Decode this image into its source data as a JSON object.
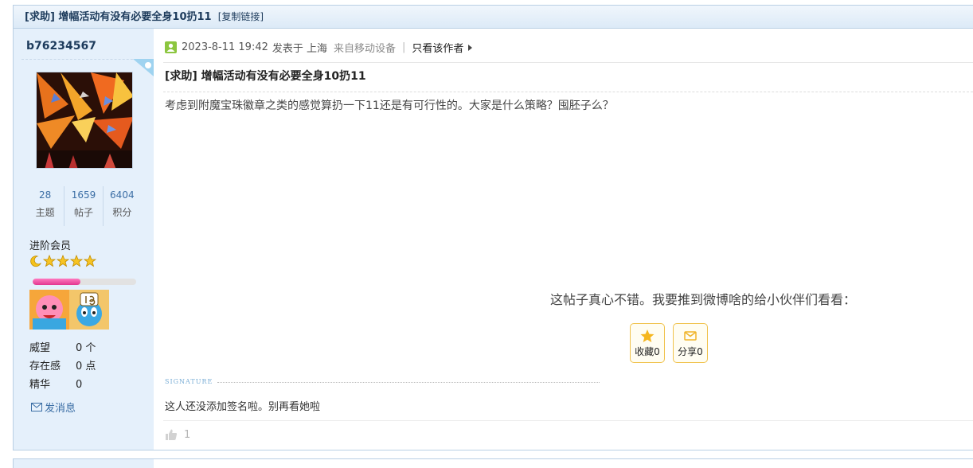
{
  "thread": {
    "title": "[求助] 增幅活动有没有必要全身10扔11",
    "copy_link": "[复制链接]"
  },
  "author": {
    "username": "b76234567",
    "stats": [
      {
        "value": "28",
        "label": "主题"
      },
      {
        "value": "1659",
        "label": "帖子"
      },
      {
        "value": "6404",
        "label": "积分"
      }
    ],
    "rank": "进阶会员",
    "level_progress": 0.46,
    "profile": [
      {
        "key": "威望",
        "value": "0 个"
      },
      {
        "key": "存在感",
        "value": "0 点"
      },
      {
        "key": "精华",
        "value": "0"
      }
    ],
    "send_message": "发消息"
  },
  "post": {
    "datetime": "2023-8-11 19:42",
    "posted_at": "发表于 上海",
    "device": "来自移动设备",
    "separator": "|",
    "only_author": "只看该作者",
    "title": "[求助] 增幅活动有没有必要全身10扔11",
    "body": "考虑到附魔宝珠徽章之类的感觉算扔一下11还是有可行性的。大家是什么策略？囤胚子么？",
    "share_prompt": "这帖子真心不错。我要推到微博啥的给小伙伴们看看：",
    "favorite_label": "收藏0",
    "share_label": "分享0",
    "signature_label": "SIGNATURE",
    "signature": "这人还没添加签名啦。别再看她啦",
    "likes": "1"
  },
  "colors": {
    "accent_blue": "#3b6ea5",
    "sidebar_bg": "#e5f0fb",
    "button_border": "#f0c24b",
    "progress_pink": "#e23790"
  }
}
